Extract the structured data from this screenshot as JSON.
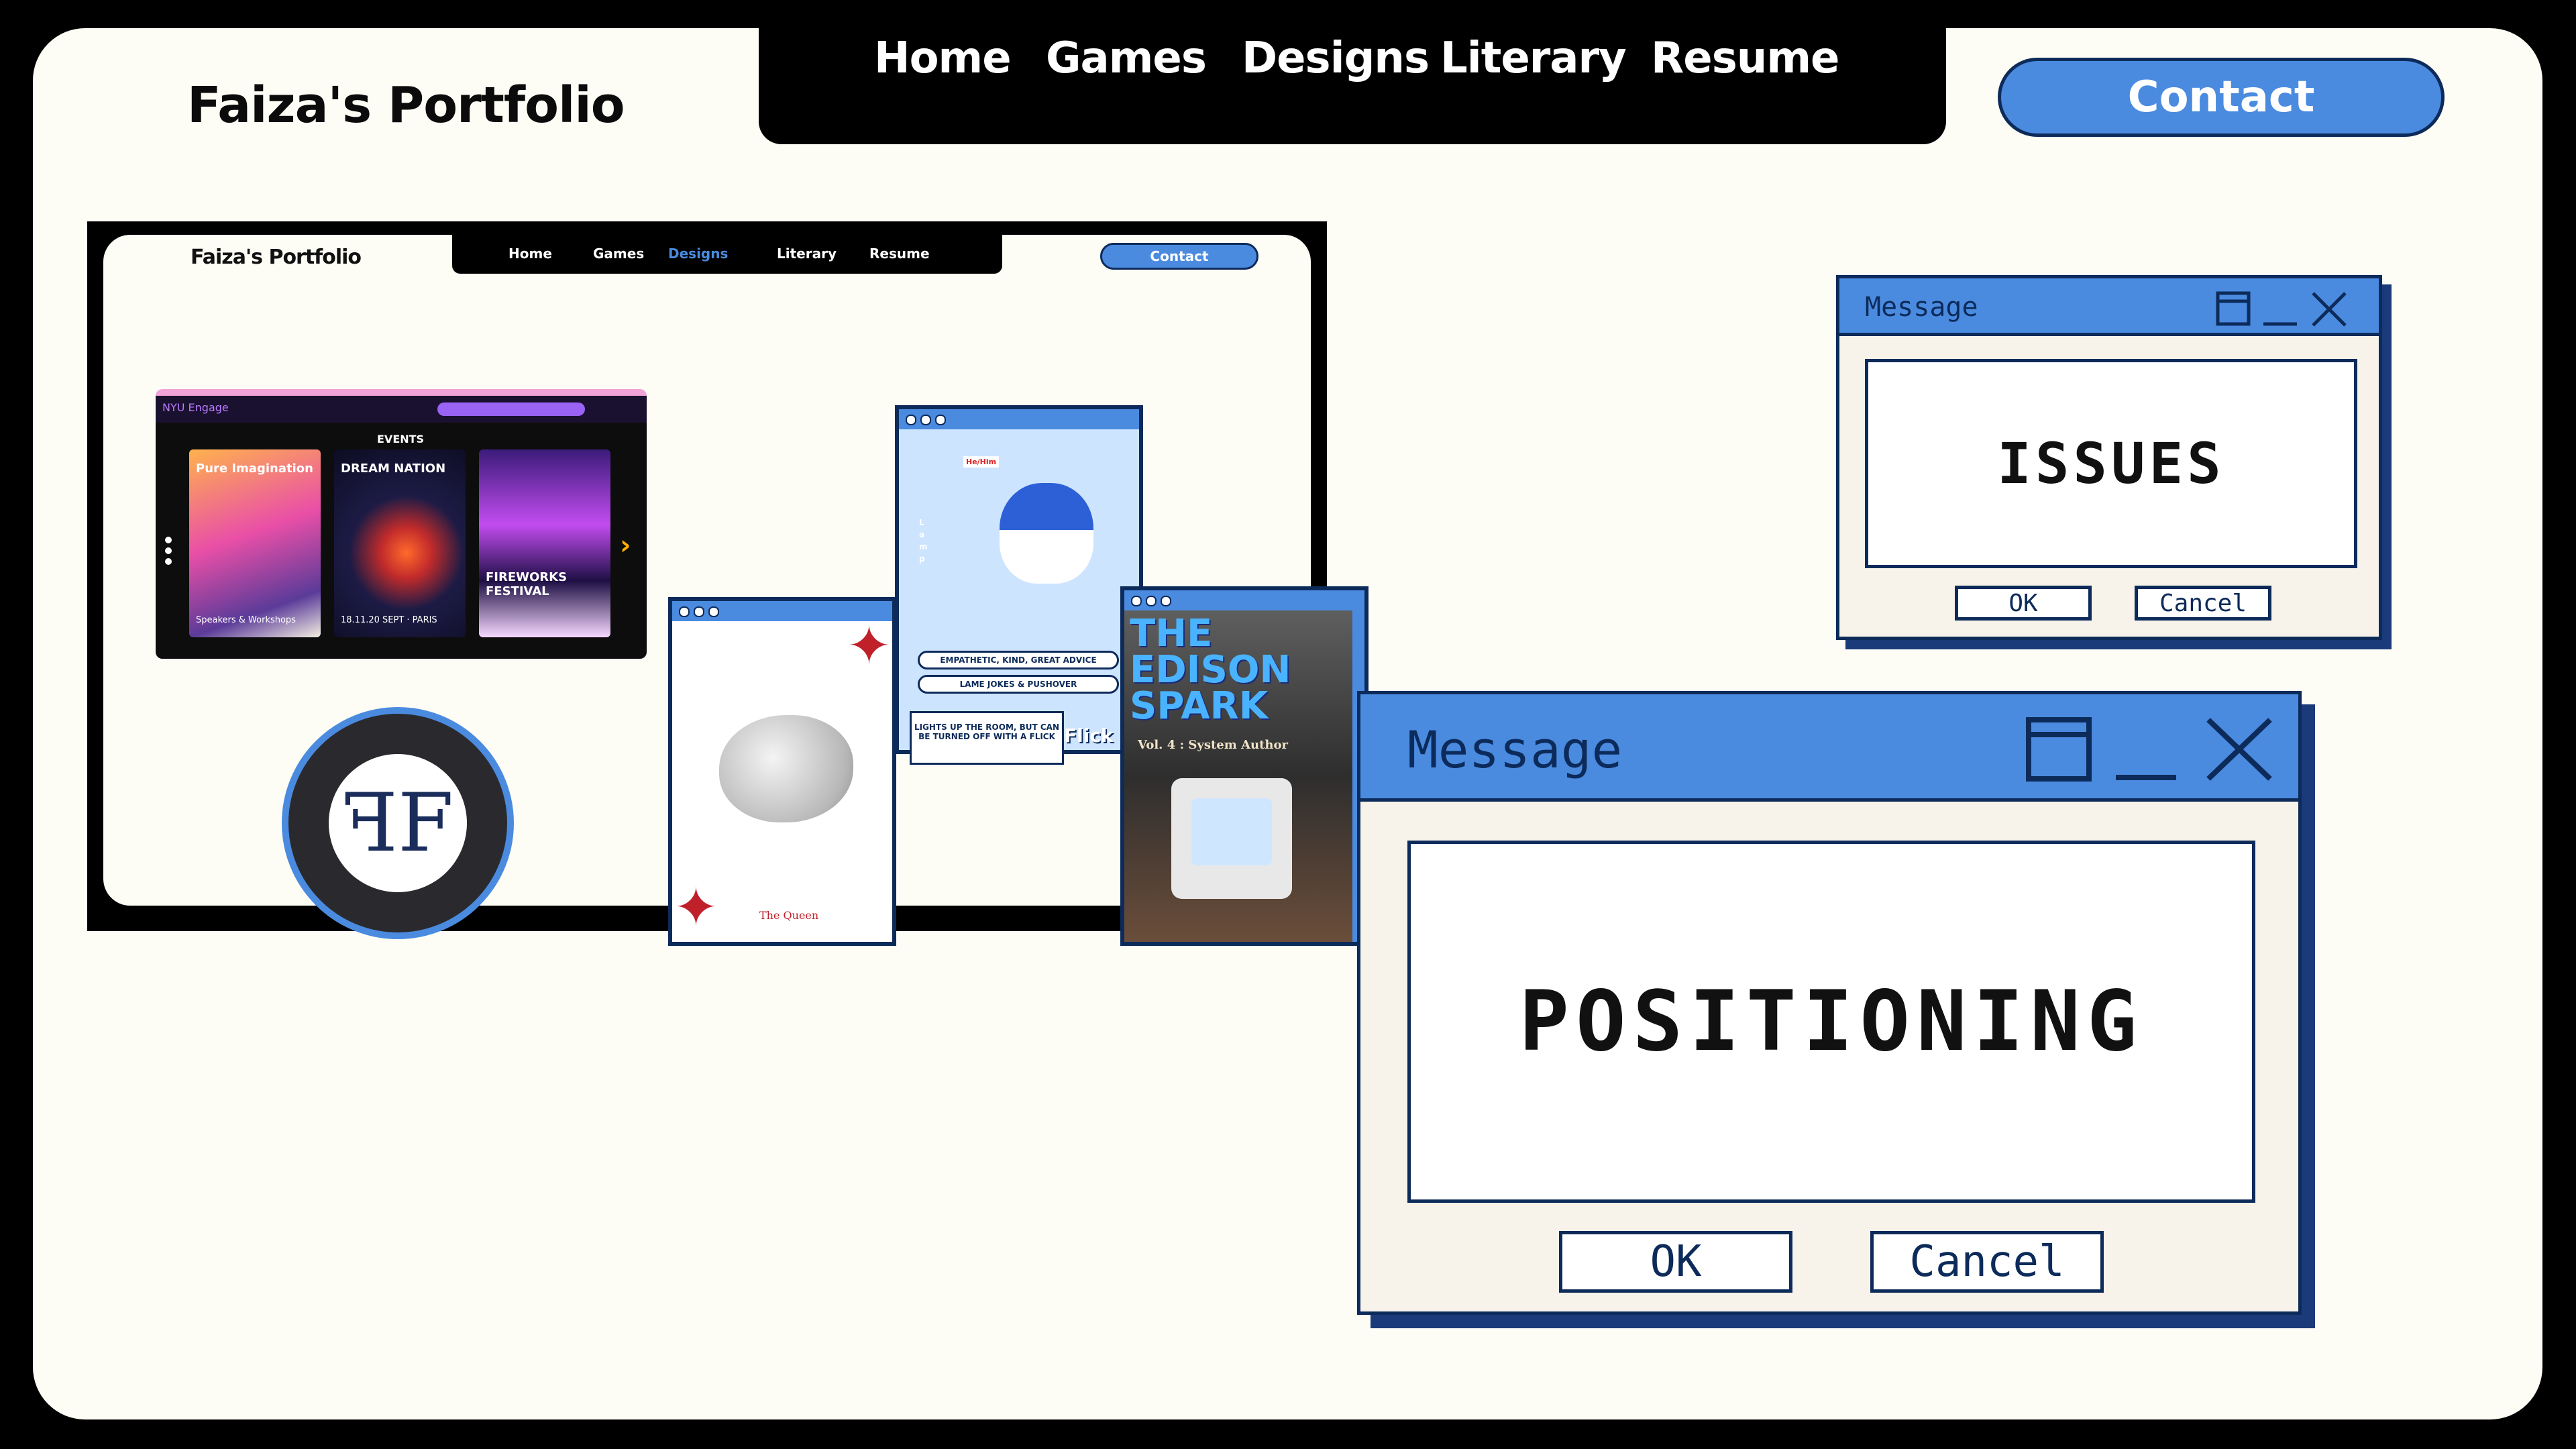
{
  "header": {
    "brand": "Faiza's Portfolio",
    "nav": [
      "Home",
      "Games",
      "Designs",
      "Literary",
      "Resume"
    ],
    "contact": "Contact"
  },
  "thumbnail": {
    "brand": "Faiza's Portfolio",
    "nav": [
      "Home",
      "Games",
      "Designs",
      "Literary",
      "Resume"
    ],
    "contact": "Contact",
    "engage": {
      "title": "NYU Engage",
      "events_label": "EVENTS",
      "posters": [
        {
          "title": "Pure Imagination",
          "footer": "Speakers & Workshops"
        },
        {
          "title": "DREAM NATION",
          "footer": "18.11.20 SEPT · PARIS"
        },
        {
          "title": "FIREWORKS FESTIVAL",
          "footer": ""
        }
      ]
    },
    "queen_card": {
      "label": "The Queen"
    },
    "lamp_card": {
      "name_tag": "He/Him",
      "side_label": "Lamp",
      "traits": [
        "EMPATHETIC, KIND, GREAT ADVICE",
        "LAME JOKES & PUSHOVER"
      ],
      "quote": "LIGHTS UP THE ROOM, BUT CAN BE TURNED OFF WITH A FLICK",
      "sticker": "Flick"
    },
    "edison_card": {
      "title_line1": "THE",
      "title_line2": "EDISON",
      "title_line3": "SPARK",
      "subtitle": "Vol. 4 : System Author"
    }
  },
  "dialog_small": {
    "title": "Message",
    "message": "ISSUES",
    "ok": "OK",
    "cancel": "Cancel"
  },
  "dialog_large": {
    "title": "Message",
    "message": "POSITIONING",
    "ok": "OK",
    "cancel": "Cancel"
  },
  "colors": {
    "accent": "#4a8be0",
    "navy": "#0d2b5a",
    "page": "#fdfcf5",
    "dialog_body": "#f7f3ea"
  }
}
